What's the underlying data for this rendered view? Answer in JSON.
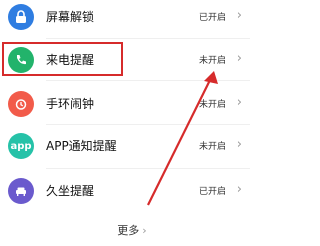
{
  "rows": [
    {
      "label": "屏幕解锁",
      "status": "已开启",
      "icon": "lock-icon",
      "color": "#2f7de1"
    },
    {
      "label": "来电提醒",
      "status": "未开启",
      "icon": "phone-icon",
      "color": "#22b36b"
    },
    {
      "label": "手环闹钟",
      "status": "未开启",
      "icon": "alarm-clock-icon",
      "color": "#f25b4a"
    },
    {
      "label": "APP通知提醒",
      "status": "未开启",
      "icon": "app-icon",
      "color": "#26c2a8",
      "icon_text": "app"
    },
    {
      "label": "久坐提醒",
      "status": "已开启",
      "icon": "sofa-icon",
      "color": "#6a5acd"
    }
  ],
  "more_label": "更多",
  "colors": {
    "highlight": "#d62b2b",
    "arrow": "#d62b2b"
  }
}
